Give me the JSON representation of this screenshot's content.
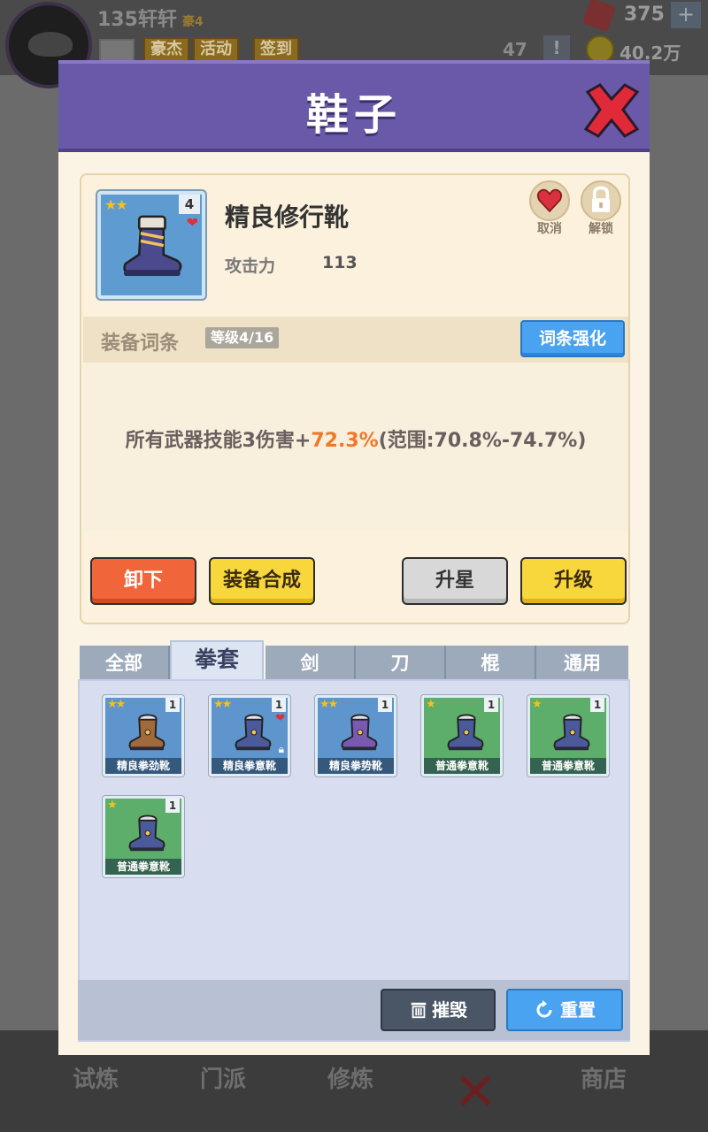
{
  "hud": {
    "player_name": "135轩轩",
    "vip_tag": "豪4",
    "tags": [
      "豪杰",
      "活动",
      "签到"
    ],
    "gems": "375",
    "resource2": "47",
    "coins": "40.2万"
  },
  "bottom_nav": [
    "试炼",
    "门派",
    "修炼",
    "商店"
  ],
  "modal": {
    "title": "鞋子",
    "item": {
      "name": "精良修行靴",
      "stars": "★★",
      "count": "4",
      "stat_label": "攻击力",
      "stat_value": "113",
      "favorite_label": "取消",
      "lock_label": "解锁"
    },
    "affix": {
      "title": "装备词条",
      "level": "等级4/16",
      "enhance_label": "词条强化",
      "line_prefix": "所有武器技能3伤害+",
      "line_highlight": "72.3%",
      "line_suffix": "(范围:70.8%-74.7%)"
    },
    "actions": {
      "unequip": "卸下",
      "compose": "装备合成",
      "star_up": "升星",
      "level_up": "升级"
    },
    "tabs": [
      "全部",
      "拳套",
      "剑",
      "刀",
      "棍",
      "通用"
    ],
    "active_tab": "拳套",
    "inventory": [
      {
        "name": "精良拳劲靴",
        "stars": "★★",
        "count": "1",
        "rarity": "blue",
        "boot_color": "#a06a3a",
        "favorite": false,
        "locked": false
      },
      {
        "name": "精良拳意靴",
        "stars": "★★",
        "count": "1",
        "rarity": "blue",
        "boot_color": "#4a5a9a",
        "favorite": true,
        "locked": true
      },
      {
        "name": "精良拳势靴",
        "stars": "★★",
        "count": "1",
        "rarity": "blue",
        "boot_color": "#7a5ab0",
        "favorite": false,
        "locked": false
      },
      {
        "name": "普通拳意靴",
        "stars": "★",
        "count": "1",
        "rarity": "green",
        "boot_color": "#4a5a9a",
        "favorite": false,
        "locked": false
      },
      {
        "name": "普通拳意靴",
        "stars": "★",
        "count": "1",
        "rarity": "green",
        "boot_color": "#4a5a9a",
        "favorite": false,
        "locked": false
      },
      {
        "name": "普通拳意靴",
        "stars": "★",
        "count": "1",
        "rarity": "green",
        "boot_color": "#4a5a9a",
        "favorite": false,
        "locked": false
      }
    ],
    "footer": {
      "destroy": "摧毁",
      "reset": "重置"
    }
  },
  "colors": {
    "header_purple": "#6a58a8",
    "accent_orange": "#f0782a",
    "button_blue": "#4aa3f0",
    "button_red": "#f0653a",
    "button_yellow": "#f7d73c"
  }
}
